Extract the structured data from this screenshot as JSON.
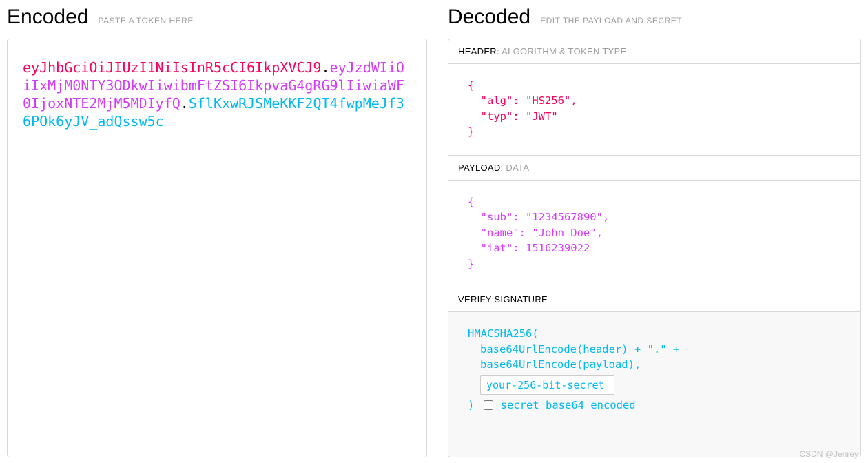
{
  "encoded": {
    "title": "Encoded",
    "hint": "PASTE A TOKEN HERE",
    "segments": {
      "header": "eyJhbGciOiJIUzI1NiIsInR5cCI6IkpXVCJ9",
      "payload": "eyJzdWIiOiIxMjM0NTY3ODkwIiwibmFtZSI6IkpvaG4gRG9lIiwiaWF0IjoxNTE2MjM5MDIyfQ",
      "signature": "SflKxwRJSMeKKF2QT4fwpMeJf36POk6yJV_adQssw5c"
    }
  },
  "decoded": {
    "title": "Decoded",
    "hint": "EDIT THE PAYLOAD AND SECRET",
    "header_section": {
      "label": "HEADER:",
      "sublabel": "ALGORITHM & TOKEN TYPE",
      "json": "{\n  \"alg\": \"HS256\",\n  \"typ\": \"JWT\"\n}",
      "data": {
        "alg": "HS256",
        "typ": "JWT"
      }
    },
    "payload_section": {
      "label": "PAYLOAD:",
      "sublabel": "DATA",
      "json": "{\n  \"sub\": \"1234567890\",\n  \"name\": \"John Doe\",\n  \"iat\": 1516239022\n}",
      "data": {
        "sub": "1234567890",
        "name": "John Doe",
        "iat": 1516239022
      }
    },
    "signature_section": {
      "label": "VERIFY SIGNATURE",
      "algo": "HMACSHA256(",
      "line1": "base64UrlEncode(header) + \".\" +",
      "line2": "base64UrlEncode(payload),",
      "secret_value": "your-256-bit-secret",
      "close": ")",
      "checkbox_label": "secret base64 encoded",
      "checkbox_checked": false
    }
  },
  "watermark": "CSDN @Jenrey"
}
